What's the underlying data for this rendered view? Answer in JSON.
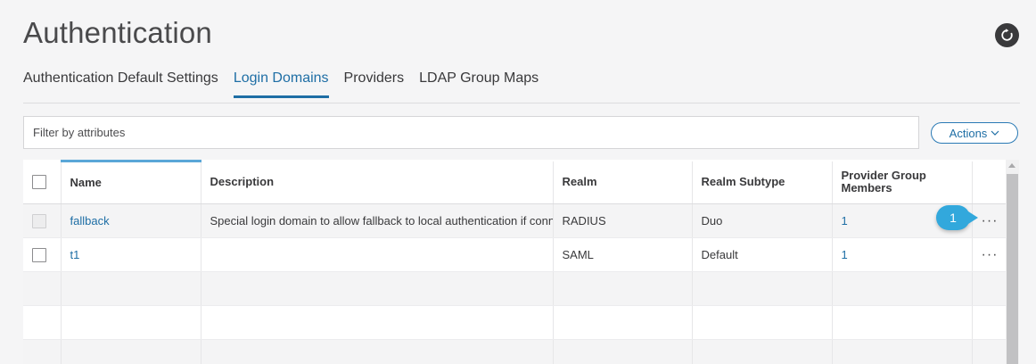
{
  "header": {
    "title": "Authentication",
    "refresh_icon": "refresh-icon"
  },
  "tabs": [
    {
      "label": "Authentication Default Settings",
      "active": false
    },
    {
      "label": "Login Domains",
      "active": true
    },
    {
      "label": "Providers",
      "active": false
    },
    {
      "label": "LDAP Group Maps",
      "active": false
    }
  ],
  "filter": {
    "placeholder": "Filter by attributes"
  },
  "actions": {
    "label": "Actions",
    "icon": "chevron-down-icon"
  },
  "table": {
    "columns": [
      "Name",
      "Description",
      "Realm",
      "Realm Subtype",
      "Provider Group Members"
    ],
    "rows": [
      {
        "name": "fallback",
        "description": "Special login domain to allow fallback to local authentication if connectivity is lost",
        "realm": "RADIUS",
        "subtype": "Duo",
        "members": "1"
      },
      {
        "name": "t1",
        "description": "",
        "realm": "SAML",
        "subtype": "Default",
        "members": "1"
      }
    ],
    "row_actions_icon": "more-dots-icon"
  },
  "callout": {
    "number": "1"
  },
  "colors": {
    "accent": "#1e6ea5",
    "callout": "#32a8dc"
  }
}
